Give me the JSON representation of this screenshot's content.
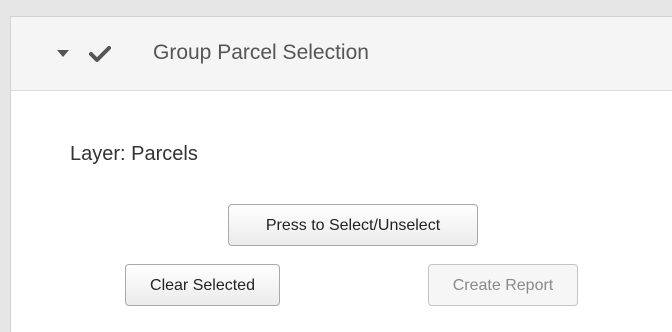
{
  "panel": {
    "title": "Group Parcel Selection",
    "collapse_icon": "caret-down-icon",
    "status_icon": "checkmark-icon"
  },
  "content": {
    "layer_label": "Layer: Parcels"
  },
  "buttons": {
    "select_unselect": "Press to Select/Unselect",
    "clear_selected": "Clear Selected",
    "create_report": "Create Report",
    "create_report_disabled": true
  },
  "colors": {
    "header_bg": "#f5f5f5",
    "text": "#555555",
    "disabled_text": "#8a8a8a"
  }
}
